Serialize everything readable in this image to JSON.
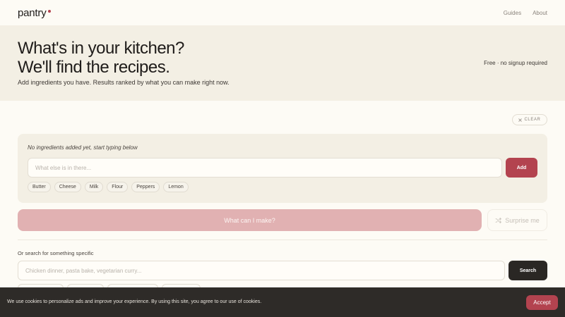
{
  "nav": {
    "logo": "pantry",
    "links": [
      "Guides",
      "About"
    ]
  },
  "hero": {
    "title_line1": "What's in your kitchen?",
    "title_line2": "We'll find the recipes.",
    "subtitle": "Add ingredients you have. Results ranked by what you can make right now.",
    "free_note": "Free · no signup required"
  },
  "ingredients": {
    "clear_label": "CLEAR",
    "clear_icon": "close-icon",
    "empty_message": "No ingredients added yet, start typing below",
    "input_placeholder": "What else is in there...",
    "input_value": "",
    "add_label": "Add",
    "quick_chips": [
      "Butter",
      "Cheese",
      "Milk",
      "Flour",
      "Peppers",
      "Lemon"
    ]
  },
  "actions": {
    "make_label": "What can I make?",
    "surprise_label": "Surprise me",
    "surprise_icon": "shuffle-icon"
  },
  "search": {
    "label": "Or search for something specific",
    "placeholder": "Chicken dinner, pasta bake, vegetarian curry...",
    "value": "",
    "button_label": "Search"
  },
  "cookie": {
    "message": "We use cookies to personalize ads and improve your experience. By using this site, you agree to our use of cookies.",
    "accept_label": "Accept"
  },
  "colors": {
    "accent": "#b3434f",
    "accent_muted": "#e1b1b2",
    "panel": "#f3efe4",
    "background": "#fdfbf5",
    "dark": "#2a2724"
  }
}
